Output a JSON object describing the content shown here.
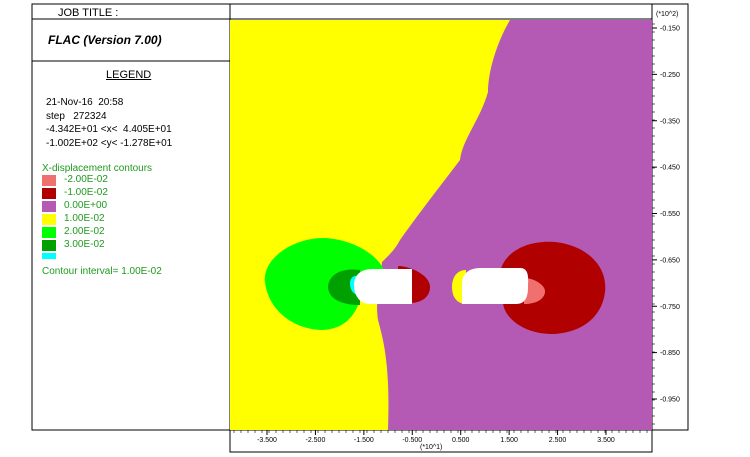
{
  "header": {
    "job_title_label": "JOB TITLE :",
    "app_title": "FLAC (Version 7.00)"
  },
  "legend": {
    "heading": "LEGEND",
    "datetime": "21-Nov-16  20:58",
    "step": "step   272324",
    "x_range": "-4.342E+01 <x<  4.405E+01",
    "y_range": "-1.002E+02 <y< -1.278E+01",
    "contour_title": "X-displacement contours",
    "levels": [
      {
        "label": "-2.00E-02",
        "color": "#f07070"
      },
      {
        "label": "-1.00E-02",
        "color": "#b00000"
      },
      {
        "label": "0.00E+00",
        "color": "#b45ab4"
      },
      {
        "label": "1.00E-02",
        "color": "#ffff00"
      },
      {
        "label": "2.00E-02",
        "color": "#00ff00"
      },
      {
        "label": "3.00E-02",
        "color": "#00a000"
      }
    ],
    "extra_swatch_color": "#00ffff",
    "interval": "Contour interval= 1.00E-02"
  },
  "chart_data": {
    "type": "heatmap",
    "description_of_fields": "FLAC x-displacement contour plot of two openings",
    "x_axis": {
      "multiplier_label": "(*10^1)",
      "ticks": [
        -3.5,
        -2.5,
        -1.5,
        -0.5,
        0.5,
        1.5,
        2.5,
        3.5
      ],
      "tick_labels": [
        "-3.500",
        "-2.500",
        "-1.500",
        "-0.500",
        "0.500",
        "1.500",
        "2.500",
        "3.500"
      ],
      "range": [
        -4.342,
        4.405
      ]
    },
    "y_axis": {
      "multiplier_label": "(*10^2)",
      "ticks": [
        -0.15,
        -0.25,
        -0.35,
        -0.45,
        -0.55,
        -0.65,
        -0.75,
        -0.85,
        -0.95
      ],
      "tick_labels": [
        "-0.150",
        "-0.250",
        "-0.350",
        "-0.450",
        "-0.550",
        "-0.650",
        "-0.750",
        "-0.850",
        "-0.950"
      ],
      "range": [
        -1.002,
        -0.1278
      ]
    },
    "colors": {
      "pos_small": "#ffff00",
      "neg_small": "#b45ab4",
      "pos_medium": "#00ff00",
      "pos_large": "#00a000",
      "neg_medium": "#b00000",
      "neg_large": "#f07070",
      "opening": "#ffffff"
    }
  }
}
